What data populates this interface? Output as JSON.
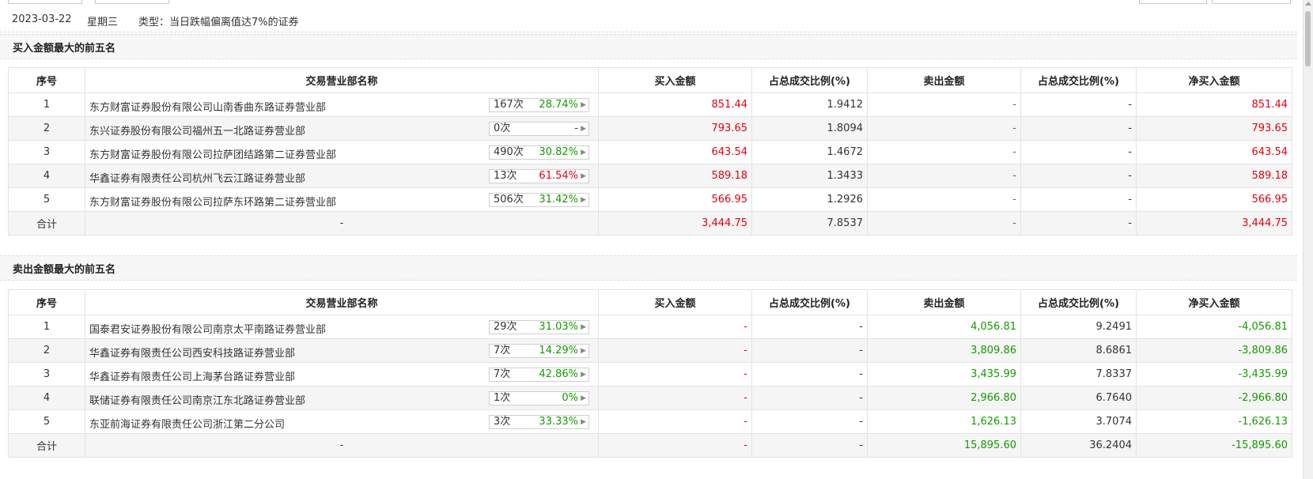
{
  "info": {
    "date": "2023-03-22",
    "weekday": "星期三",
    "type_text": "类型：当日跌幅偏离值达7%的证券"
  },
  "columns": [
    "序号",
    "交易营业部名称",
    "买入金额",
    "占总成交比例(%)",
    "卖出金额",
    "占总成交比例(%)",
    "净买入金额"
  ],
  "colors": {
    "up": "#e60012",
    "down": "#159b00"
  },
  "buy_section": {
    "title": "买入金额最大的前五名",
    "rows": [
      {
        "idx": "1",
        "name": "东方财富证券股份有限公司山南香曲东路证券营业部",
        "count": "167次",
        "pct": "28.74%",
        "pct_color": "green",
        "buy": "851.44",
        "buy_ratio": "1.9412",
        "sell": "-",
        "sell_ratio": "-",
        "net": "851.44"
      },
      {
        "idx": "2",
        "name": "东兴证券股份有限公司福州五一北路证券营业部",
        "count": "0次",
        "pct": "-",
        "pct_color": "none",
        "buy": "793.65",
        "buy_ratio": "1.8094",
        "sell": "-",
        "sell_ratio": "-",
        "net": "793.65"
      },
      {
        "idx": "3",
        "name": "东方财富证券股份有限公司拉萨团结路第二证券营业部",
        "count": "490次",
        "pct": "30.82%",
        "pct_color": "green",
        "buy": "643.54",
        "buy_ratio": "1.4672",
        "sell": "-",
        "sell_ratio": "-",
        "net": "643.54"
      },
      {
        "idx": "4",
        "name": "华鑫证券有限责任公司杭州飞云江路证券营业部",
        "count": "13次",
        "pct": "61.54%",
        "pct_color": "red",
        "buy": "589.18",
        "buy_ratio": "1.3433",
        "sell": "-",
        "sell_ratio": "-",
        "net": "589.18"
      },
      {
        "idx": "5",
        "name": "东方财富证券股份有限公司拉萨东环路第二证券营业部",
        "count": "506次",
        "pct": "31.42%",
        "pct_color": "green",
        "buy": "566.95",
        "buy_ratio": "1.2926",
        "sell": "-",
        "sell_ratio": "-",
        "net": "566.95"
      }
    ],
    "total": {
      "label": "合计",
      "name": "-",
      "buy": "3,444.75",
      "buy_ratio": "7.8537",
      "sell": "-",
      "sell_ratio": "-",
      "net": "3,444.75"
    }
  },
  "sell_section": {
    "title": "卖出金额最大的前五名",
    "rows": [
      {
        "idx": "1",
        "name": "国泰君安证券股份有限公司南京太平南路证券营业部",
        "count": "29次",
        "pct": "31.03%",
        "pct_color": "green",
        "buy": "-",
        "buy_ratio": "-",
        "sell": "4,056.81",
        "sell_ratio": "9.2491",
        "net": "-4,056.81"
      },
      {
        "idx": "2",
        "name": "华鑫证券有限责任公司西安科技路证券营业部",
        "count": "7次",
        "pct": "14.29%",
        "pct_color": "green",
        "buy": "-",
        "buy_ratio": "-",
        "sell": "3,809.86",
        "sell_ratio": "8.6861",
        "net": "-3,809.86"
      },
      {
        "idx": "3",
        "name": "华鑫证券有限责任公司上海茅台路证券营业部",
        "count": "7次",
        "pct": "42.86%",
        "pct_color": "green",
        "buy": "-",
        "buy_ratio": "-",
        "sell": "3,435.99",
        "sell_ratio": "7.8337",
        "net": "-3,435.99"
      },
      {
        "idx": "4",
        "name": "联储证券有限责任公司南京江东北路证券营业部",
        "count": "1次",
        "pct": "0%",
        "pct_color": "green",
        "buy": "-",
        "buy_ratio": "-",
        "sell": "2,966.80",
        "sell_ratio": "6.7640",
        "net": "-2,966.80"
      },
      {
        "idx": "5",
        "name": "东亚前海证券有限责任公司浙江第二分公司",
        "count": "3次",
        "pct": "33.33%",
        "pct_color": "green",
        "buy": "-",
        "buy_ratio": "-",
        "sell": "1,626.13",
        "sell_ratio": "3.7074",
        "net": "-1,626.13"
      }
    ],
    "total": {
      "label": "合计",
      "name": "-",
      "buy": "-",
      "buy_ratio": "-",
      "sell": "15,895.60",
      "sell_ratio": "36.2404",
      "net": "-15,895.60"
    }
  }
}
